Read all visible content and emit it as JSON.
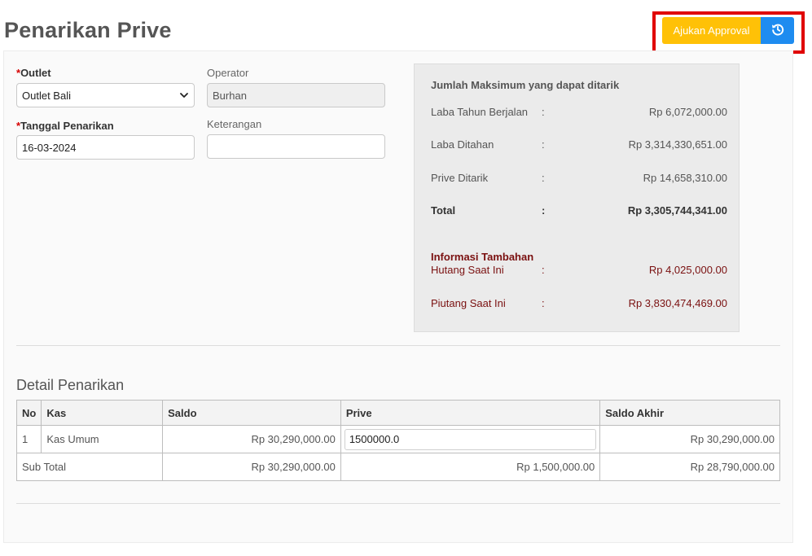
{
  "page": {
    "title": "Penarikan Prive"
  },
  "toolbar": {
    "approval_label": "Ajukan Approval",
    "reset_icon": "history-reset-icon",
    "approval_color": "#ffc107",
    "reset_color": "#1e8cf0",
    "highlight_color": "#e00000"
  },
  "form": {
    "required_mark": "*",
    "outlet": {
      "label": "Outlet",
      "value": "Outlet Bali"
    },
    "operator": {
      "label": "Operator",
      "value": "Burhan"
    },
    "tanggal": {
      "label": "Tanggal Penarikan",
      "value": "16-03-2024"
    },
    "keterangan": {
      "label": "Keterangan",
      "value": ""
    }
  },
  "summary": {
    "title": "Jumlah Maksimum yang dapat ditarik",
    "separator": ":",
    "rows": [
      {
        "label": "Laba Tahun Berjalan",
        "value": "Rp 6,072,000.00"
      },
      {
        "label": "Laba Ditahan",
        "value": "Rp 3,314,330,651.00"
      },
      {
        "label": "Prive Ditarik",
        "value": "Rp 14,658,310.00"
      },
      {
        "label": "Total",
        "value": "Rp 3,305,744,341.00"
      }
    ],
    "info_title": "Informasi Tambahan",
    "info_rows": [
      {
        "label": "Hutang Saat Ini",
        "value": "Rp 4,025,000.00"
      },
      {
        "label": "Piutang Saat Ini",
        "value": "Rp 3,830,474,469.00"
      }
    ],
    "info_color": "#7a1010"
  },
  "detail": {
    "title": "Detail Penarikan",
    "columns": [
      "No",
      "Kas",
      "Saldo",
      "Prive",
      "Saldo Akhir"
    ],
    "rows": [
      {
        "no": "1",
        "kas": "Kas Umum",
        "saldo": "Rp 30,290,000.00",
        "prive": "1500000.0",
        "saldo_akhir": "Rp 30,290,000.00"
      }
    ],
    "subtotal": {
      "label": "Sub Total",
      "saldo": "Rp 30,290,000.00",
      "prive": "Rp 1,500,000.00",
      "saldo_akhir": "Rp 28,790,000.00"
    }
  }
}
